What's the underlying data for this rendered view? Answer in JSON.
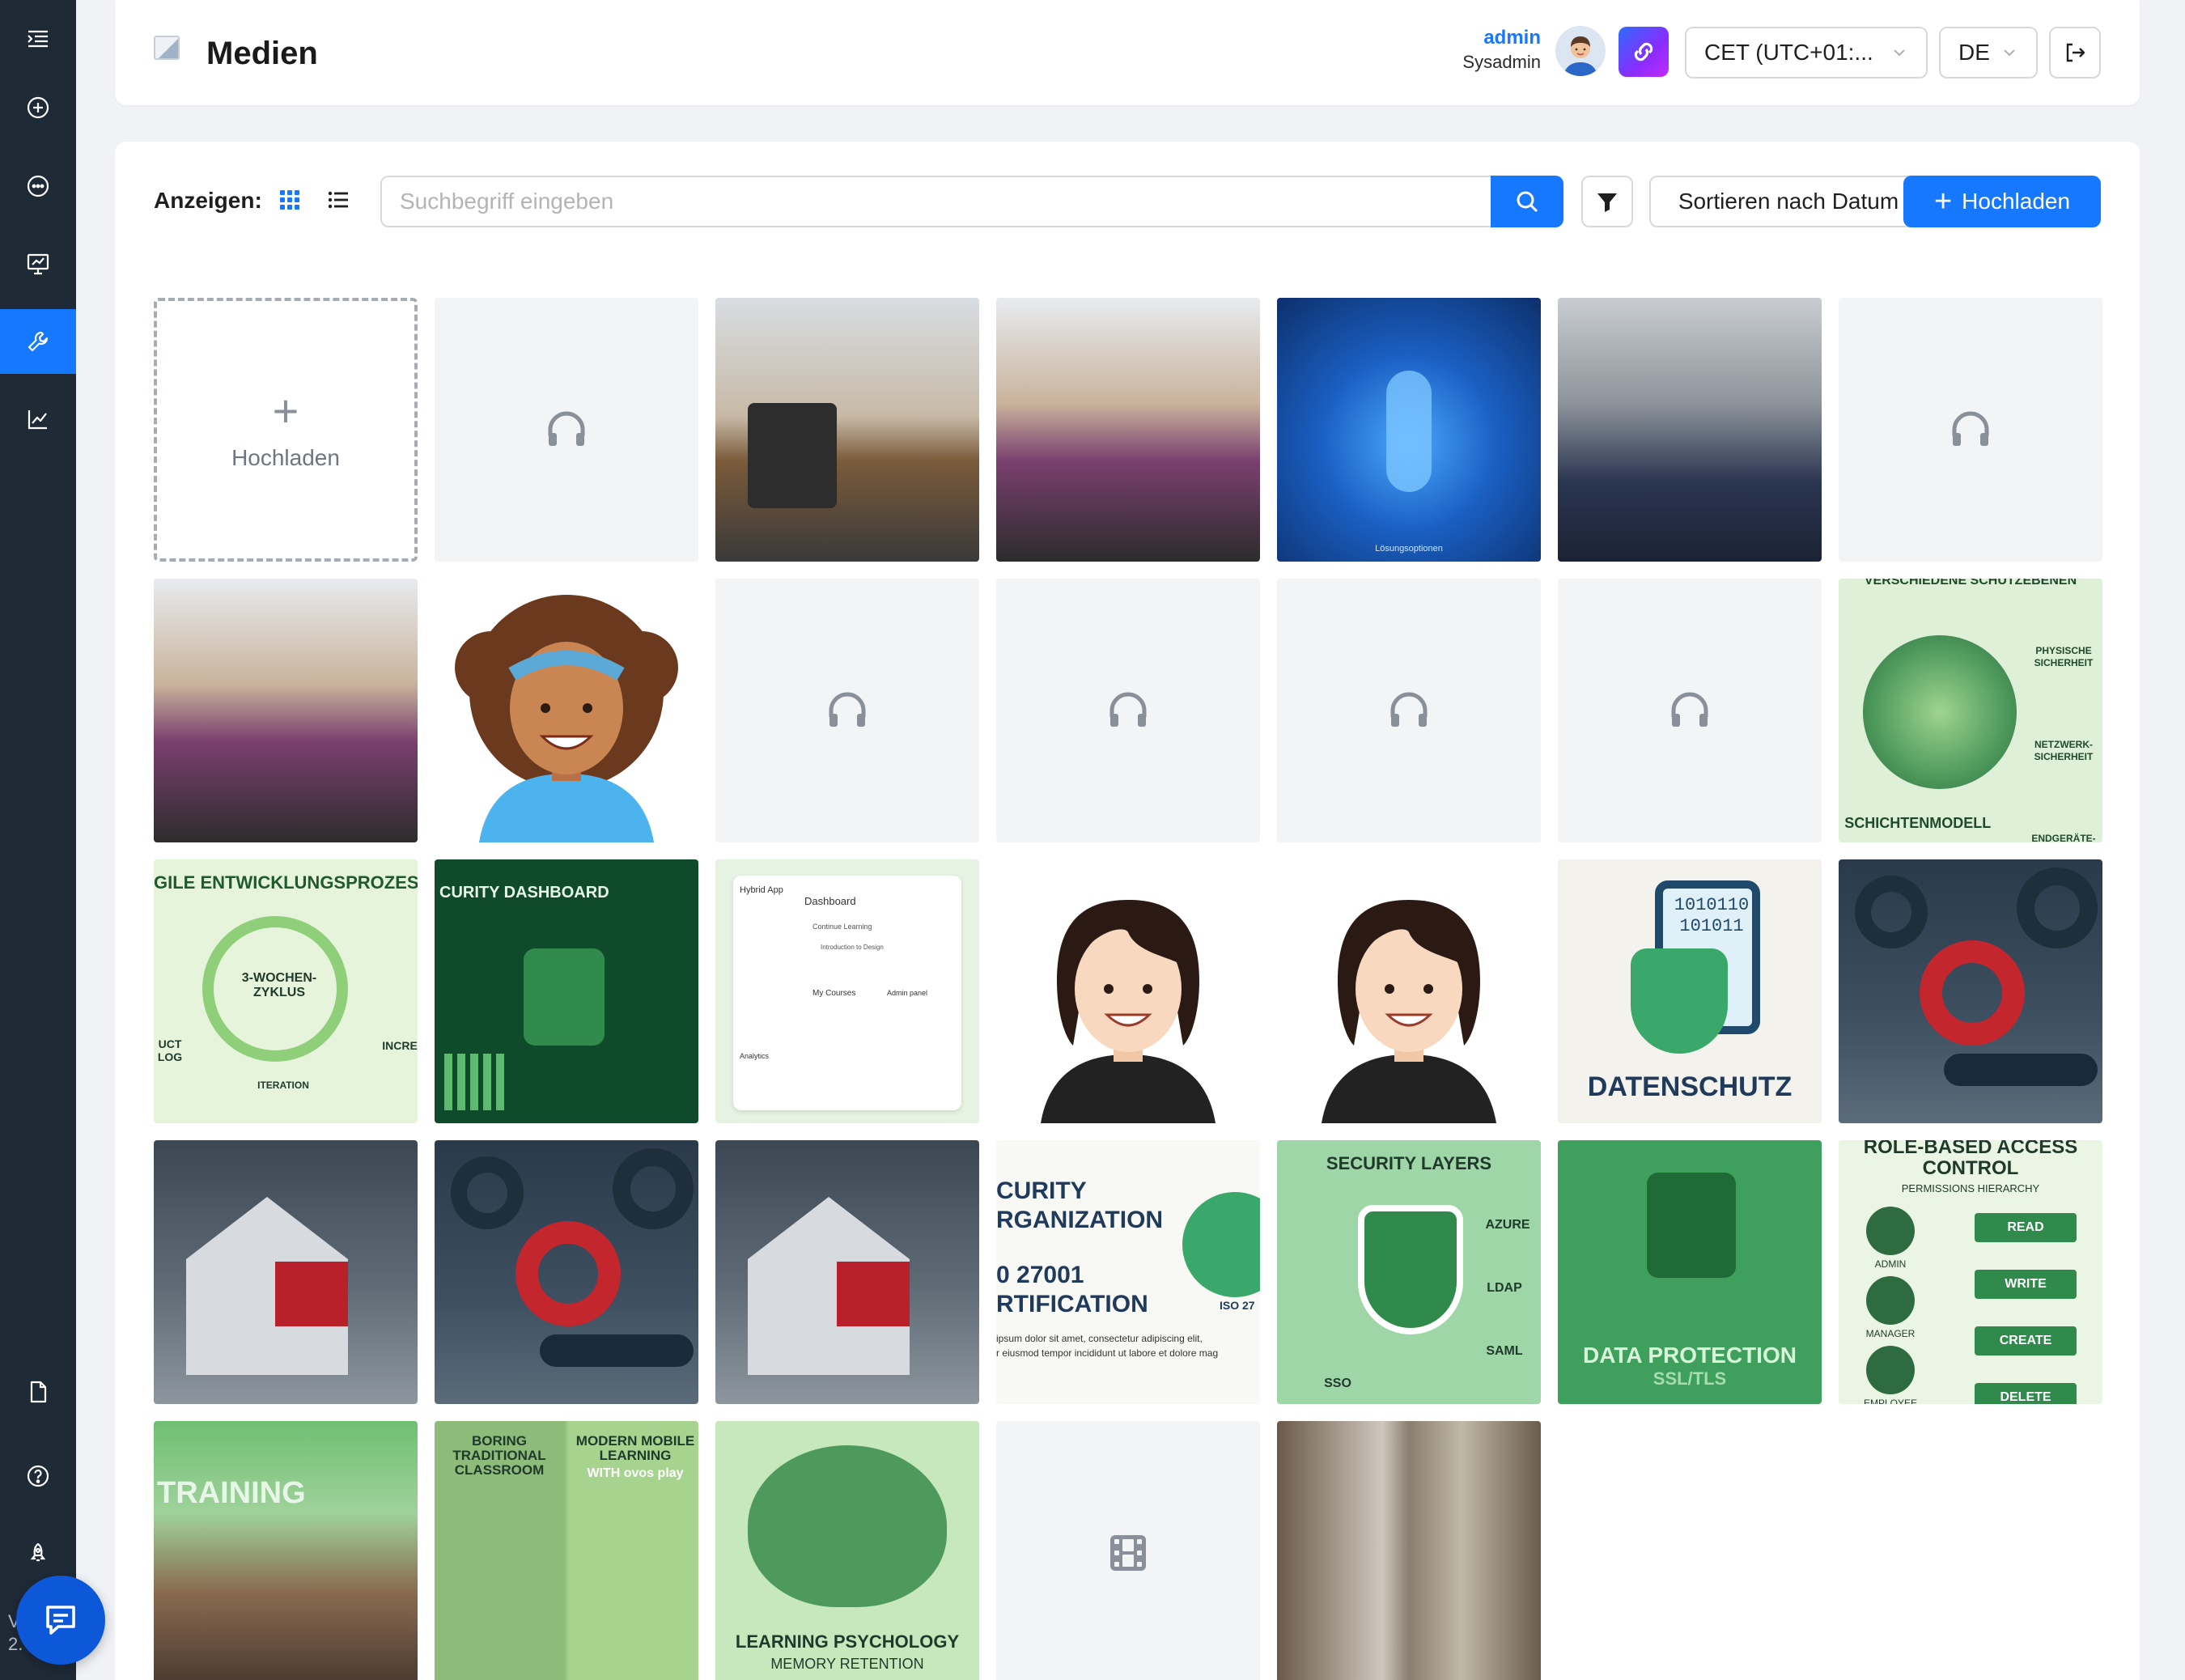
{
  "header": {
    "title": "Medien",
    "user_name": "admin",
    "user_role": "Sysadmin",
    "timezone": "CET (UTC+01:...",
    "language": "DE"
  },
  "sidebar": {
    "items": [
      {
        "icon": "menu-indent-icon"
      },
      {
        "icon": "add-circle-icon"
      },
      {
        "icon": "chat-bubble-icon"
      },
      {
        "icon": "presentation-icon"
      },
      {
        "icon": "wrench-icon",
        "active": true
      },
      {
        "icon": "line-chart-icon"
      },
      {
        "icon": "document-icon"
      },
      {
        "icon": "help-icon"
      },
      {
        "icon": "rocket-icon"
      }
    ],
    "version_label": "V\n2."
  },
  "toolbar": {
    "view_label": "Anzeigen:",
    "search_placeholder": "Suchbegriff eingeben",
    "sort_label": "Sortieren nach Datum",
    "upload_label": "Hochladen"
  },
  "grid": {
    "upload_tile_label": "Hochladen",
    "tiles": [
      {
        "type": "audio"
      },
      {
        "type": "image",
        "subject": "coffee-machine-photo"
      },
      {
        "type": "image",
        "subject": "pharmacy-photo"
      },
      {
        "type": "image",
        "subject": "blue-tech-infographic",
        "caption": "Lösungsoptionen"
      },
      {
        "type": "image",
        "subject": "train-conductor-photo"
      },
      {
        "type": "audio"
      },
      {
        "type": "image",
        "subject": "pharmacy-photo-2"
      },
      {
        "type": "image",
        "subject": "cartoon-avatar-curly"
      },
      {
        "type": "audio"
      },
      {
        "type": "audio"
      },
      {
        "type": "audio"
      },
      {
        "type": "audio"
      },
      {
        "type": "image",
        "subject": "layer-model",
        "caption": "SCHICHTENMODELL",
        "top": "VERSCHIEDENE SCHUTZEBENEN",
        "labels": [
          "PHYSISCHE SICHERHEIT",
          "NETZWERK-SICHERHEIT",
          "ENDGERÄTE-SICHERHEIT"
        ]
      },
      {
        "type": "image",
        "subject": "agile-cycle",
        "caption": "GILE ENTWICKLUNGSPROZES",
        "labels": [
          "3-WOCHEN-ZYKLUS",
          "UCT LOG",
          "INCRE",
          "ITERATION"
        ]
      },
      {
        "type": "image",
        "subject": "security-dashboard",
        "caption": "CURITY DASHBOARD"
      },
      {
        "type": "image",
        "subject": "app-mockup",
        "labels": [
          "Hybrid App",
          "Dashboard",
          "Continue Learning",
          "Introduction to Design",
          "My Courses",
          "Admin panel",
          "Analytics"
        ]
      },
      {
        "type": "image",
        "subject": "cartoon-avatar-dark-hair"
      },
      {
        "type": "image",
        "subject": "cartoon-avatar-dark-hair-2"
      },
      {
        "type": "image",
        "subject": "data-protection-illustration",
        "caption": "DATENSCHUTZ",
        "labels": [
          "1010110",
          "101011"
        ]
      },
      {
        "type": "image",
        "subject": "gears-hand"
      },
      {
        "type": "image",
        "subject": "puzzle-house"
      },
      {
        "type": "image",
        "subject": "gears-hand-2"
      },
      {
        "type": "image",
        "subject": "puzzle-house-2"
      },
      {
        "type": "image",
        "subject": "iso-certification",
        "labels": [
          "CURITY",
          "RGANIZATION",
          "0 27001",
          "RTIFICATION",
          "ISO 27",
          "ipsum dolor sit amet, consectetur adipiscing elit,",
          "r eiusmod tempor incididunt ut labore et dolore mag"
        ]
      },
      {
        "type": "image",
        "subject": "security-layers",
        "caption": "SECURITY LAYERS",
        "labels": [
          "AZURE",
          "LDAP",
          "SAML",
          "SSO"
        ]
      },
      {
        "type": "image",
        "subject": "data-protection-ssl",
        "caption": "DATA PROTECTION",
        "sub": "SSL/TLS"
      },
      {
        "type": "image",
        "subject": "rbac",
        "caption": "ROLE-BASED ACCESS CONTROL",
        "sub": "PERMISSIONS HIERARCHY",
        "labels": [
          "READ",
          "WRITE",
          "CREATE",
          "DELETE",
          "ADMIN",
          "MANAGER",
          "EMPLOYEE"
        ]
      },
      {
        "type": "image",
        "subject": "training-classroom-photo",
        "caption": "TRAINING"
      },
      {
        "type": "image",
        "subject": "classroom-vs-mobile",
        "labels": [
          "BORING TRADITIONAL CLASSROOM",
          "MODERN MOBILE LEARNING",
          "WITH ovos play"
        ]
      },
      {
        "type": "image",
        "subject": "brain-network",
        "caption": "LEARNING PSYCHOLOGY",
        "sub": "MEMORY RETENTION"
      },
      {
        "type": "video"
      },
      {
        "type": "image",
        "subject": "cutting-vegetables-photo"
      }
    ]
  },
  "colors": {
    "primary": "#1677ff",
    "sidebar": "#1f2a37",
    "page_bg": "#f0f2f5",
    "placeholder_tile": "#f3f4f6"
  }
}
